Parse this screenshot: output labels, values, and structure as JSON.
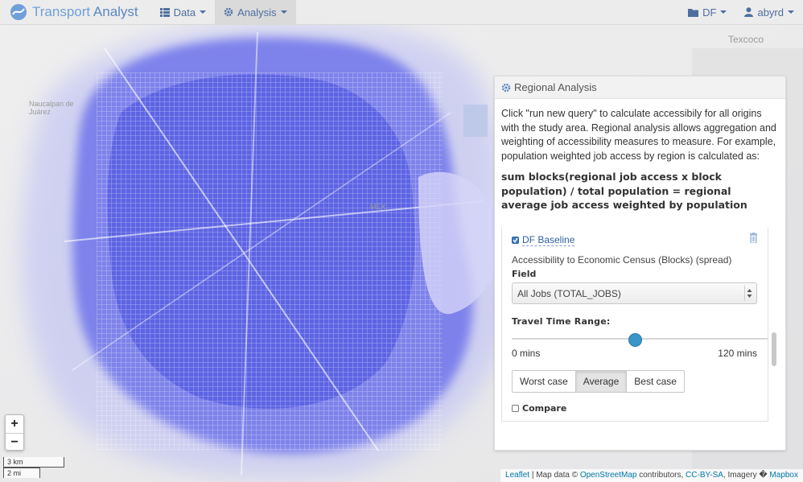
{
  "navbar": {
    "brand": "Transport Analyst",
    "brand_part1": "Transport",
    "brand_part2": " Analyst",
    "menu": [
      {
        "label": "Data",
        "icon": "list-icon"
      },
      {
        "label": "Analysis",
        "icon": "gear-icon"
      }
    ],
    "project": {
      "label": "DF",
      "icon": "folder-icon"
    },
    "user": {
      "label": "abyrd",
      "icon": "user-icon"
    }
  },
  "map": {
    "labels": [
      "Texcoco",
      "Naucalpan de Juárez",
      "MEX"
    ],
    "accent_color": "#6f75ea"
  },
  "panel": {
    "title": "Regional Analysis",
    "description": "Click \"run new query\" to calculate accessibily for all origins with the study area. Regional analysis allows aggregation and weighting of accessibility measures to measure. For example, population weighted job access by region is calculated as:",
    "formula": "sum blocks(regional job access x block population) / total population = regional average job access weighted by population",
    "scenario": {
      "name": "DF Baseline",
      "checked": true,
      "accessibility": "Accessibility to Economic Census (Blocks) (spread)",
      "field_label": "Field",
      "field_value": "All Jobs (TOTAL_JOBS)",
      "travel_time_label": "Travel Time Range:",
      "range_min": "0 mins",
      "range_max": "120 mins",
      "slider_fraction": 0.48,
      "buttons": [
        "Worst case",
        "Average",
        "Best case"
      ],
      "active_button": "Average",
      "compare_label": "Compare"
    }
  },
  "zoom": {
    "in": "+",
    "out": "−"
  },
  "scale": {
    "km": "3 km",
    "mi": "2 mi"
  },
  "attribution": {
    "leaflet": "Leaflet",
    "sep": " | Map data © ",
    "osm": "OpenStreetMap",
    "contrib": " contributors, ",
    "license": "CC-BY-SA",
    "imagery": ", Imagery � ",
    "mapbox": "Mapbox"
  }
}
